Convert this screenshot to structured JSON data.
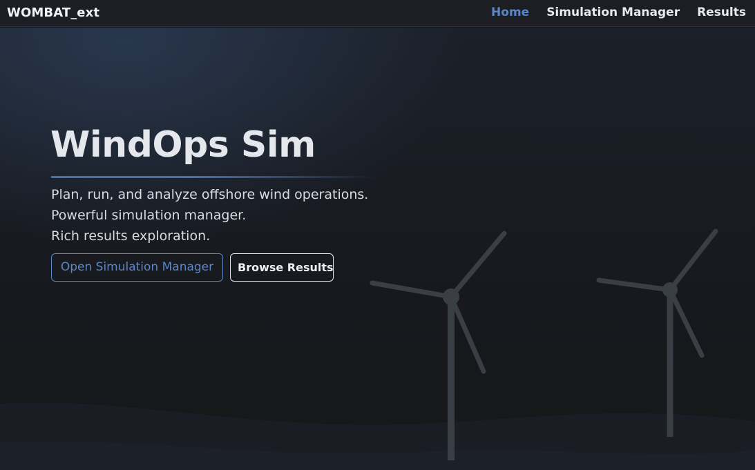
{
  "navbar": {
    "brand": "WOMBAT_ext",
    "links": [
      {
        "label": "Home",
        "active": true
      },
      {
        "label": "Simulation Manager",
        "active": false
      },
      {
        "label": "Results",
        "active": false
      }
    ]
  },
  "hero": {
    "title": "WindOps Sim",
    "taglines": [
      "Plan, run, and analyze offshore wind operations.",
      "Powerful simulation manager.",
      "Rich results exploration."
    ],
    "primary_button": "Open Simulation Manager",
    "secondary_button": "Browse Results"
  },
  "colors": {
    "accent": "#5a87c8",
    "background": "#16181d",
    "navbar": "#1c1e23",
    "turbine": "#3a3e45"
  }
}
